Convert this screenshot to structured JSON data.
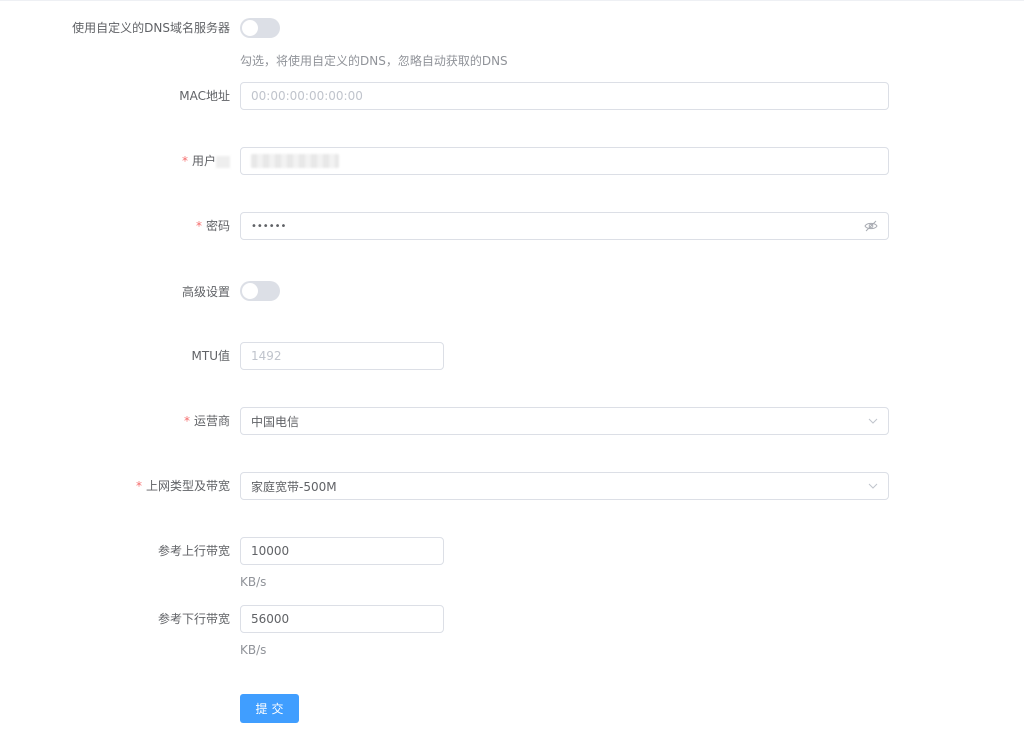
{
  "form": {
    "custom_dns": {
      "label": "使用自定义的DNS域名服务器",
      "enabled": false,
      "hint": "勾选，将使用自定义的DNS，忽略自动获取的DNS"
    },
    "mac": {
      "label": "MAC地址",
      "placeholder": "00:00:00:00:00:00"
    },
    "username": {
      "label": "用户",
      "required_mark": "*"
    },
    "password": {
      "label": "密码",
      "required_mark": "*",
      "value": "••••••"
    },
    "advanced": {
      "label": "高级设置",
      "enabled": false
    },
    "mtu": {
      "label": "MTU值",
      "placeholder": "1492"
    },
    "isp": {
      "label": "运营商",
      "required_mark": "*",
      "value": "中国电信"
    },
    "plan": {
      "label": "上网类型及带宽",
      "required_mark": "*",
      "value": "家庭宽带-500M"
    },
    "up_bandwidth": {
      "label": "参考上行带宽",
      "value": "10000",
      "unit": "KB/s"
    },
    "down_bandwidth": {
      "label": "参考下行带宽",
      "value": "56000",
      "unit": "KB/s"
    },
    "submit_label": "提交"
  }
}
